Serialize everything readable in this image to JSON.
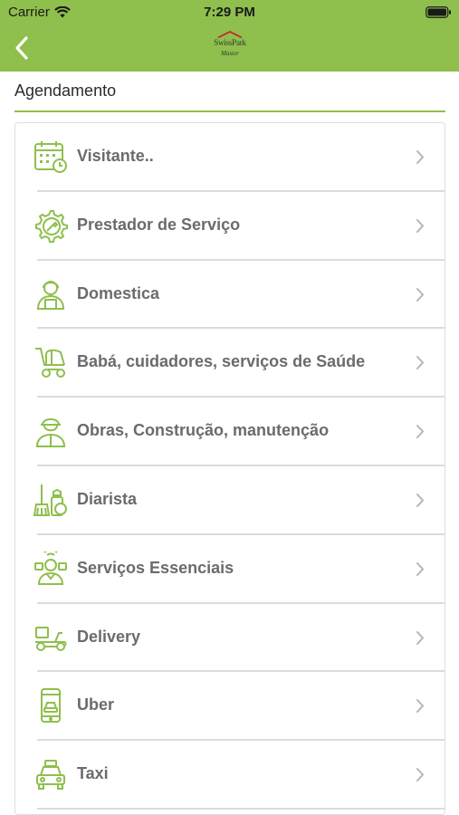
{
  "status_bar": {
    "carrier": "Carrier",
    "time": "7:29 PM"
  },
  "header": {
    "back_icon": "chevron-left-icon",
    "logo_title": "SwissPark",
    "logo_subtitle": "Master"
  },
  "section": {
    "title": "Agendamento"
  },
  "colors": {
    "accent": "#8fbf4d",
    "icon": "#8fbf4d",
    "text": "#6b6b6b",
    "chevron": "#b5b5b5"
  },
  "items": [
    {
      "label": "Visitante..",
      "icon": "calendar-clock-icon"
    },
    {
      "label": "Prestador de Serviço",
      "icon": "gear-wrench-icon"
    },
    {
      "label": "Domestica",
      "icon": "housekeeper-icon"
    },
    {
      "label": "Babá, cuidadores, serviços de Saúde",
      "icon": "stroller-icon"
    },
    {
      "label": "Obras, Construção, manutenção",
      "icon": "construction-worker-icon"
    },
    {
      "label": "Diarista",
      "icon": "cleaning-supplies-icon"
    },
    {
      "label": "Serviços Essenciais",
      "icon": "essential-worker-icon"
    },
    {
      "label": "Delivery",
      "icon": "delivery-scooter-icon"
    },
    {
      "label": "Uber",
      "icon": "phone-car-icon"
    },
    {
      "label": "Taxi",
      "icon": "taxi-icon"
    }
  ]
}
